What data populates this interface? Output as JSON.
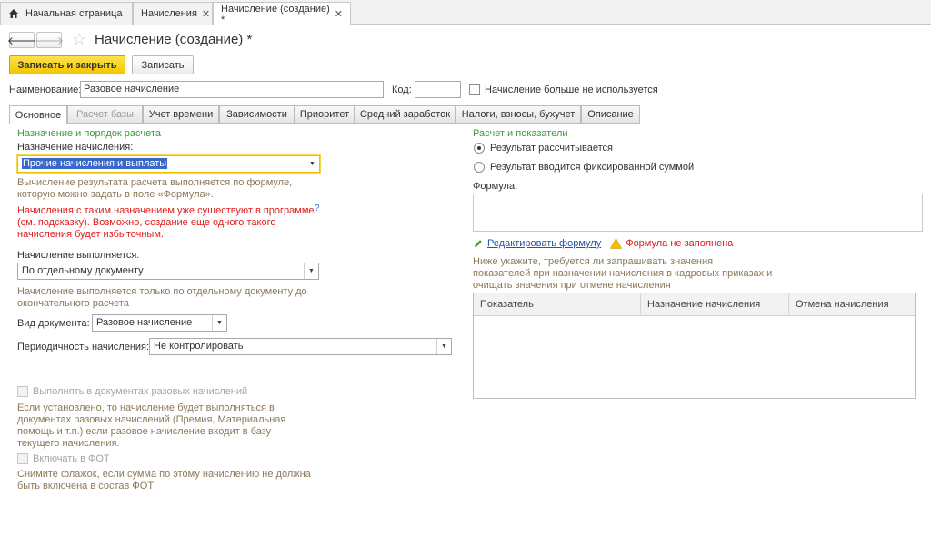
{
  "tabs": {
    "home": "Начальная страница",
    "accruals": "Начисления",
    "current": "Начисление (создание) *"
  },
  "form": {
    "title": "Начисление (создание) *",
    "save_close": "Записать и закрыть",
    "save": "Записать",
    "name_label": "Наименование:",
    "name_value": "Разовое начисление",
    "code_label": "Код:",
    "code_value": "",
    "unused_label": "Начисление больше не используется"
  },
  "form_tabs": [
    "Основное",
    "Расчет базы",
    "Учет времени",
    "Зависимости",
    "Приоритет",
    "Средний заработок",
    "Налоги, взносы, бухучет",
    "Описание"
  ],
  "left": {
    "section": "Назначение и порядок расчета",
    "purpose_label": "Назначение начисления:",
    "purpose_value": "Прочие начисления и выплаты",
    "purpose_note1": "Вычисление результата расчета выполняется по формуле,",
    "purpose_note2": "которую можно задать в поле «Формула».",
    "warning1": "Начисления с таким назначением уже существуют в программе",
    "warning2": "(см. подсказку). Возможно, создание еще одного такого",
    "warning3": "начисления будет избыточным.",
    "help": "?",
    "exec_label": "Начисление выполняется:",
    "exec_value": "По отдельному документу",
    "exec_note1": "Начисление выполняется только по отдельному документу до",
    "exec_note2": "окончательного расчета",
    "doc_label": "Вид документа:",
    "doc_value": "Разовое начисление",
    "period_label": "Периодичность начисления:",
    "period_value": "Не контролировать",
    "onetime_label": "Выполнять в документах разовых начислений",
    "onetime_note1": "Если установлено, то начисление будет выполняться в",
    "onetime_note2": "документах разовых начислений (Премия, Материальная",
    "onetime_note3": "помощь и т.п.) если разовое начисление входит в базу",
    "onetime_note4": "текущего начисления.",
    "fot_label": "Включать в ФОТ",
    "fot_note1": "Снимите флажок, если сумма по этому начислению не должна",
    "fot_note2": "быть включена в состав ФОТ"
  },
  "right": {
    "section": "Расчет и показатели",
    "radio1": "Результат рассчитывается",
    "radio2": "Результат вводится фиксированной суммой",
    "formula_label": "Формула:",
    "edit_link": "Редактировать формулу",
    "formula_warning": "Формула не заполнена",
    "hint1": "Ниже укажите, требуется ли запрашивать значения",
    "hint2": "показателей при назначении начисления в кадровых приказах и",
    "hint3": "очищать значения при отмене начисления",
    "columns": [
      "Показатель",
      "Назначение начисления",
      "Отмена начисления"
    ]
  }
}
